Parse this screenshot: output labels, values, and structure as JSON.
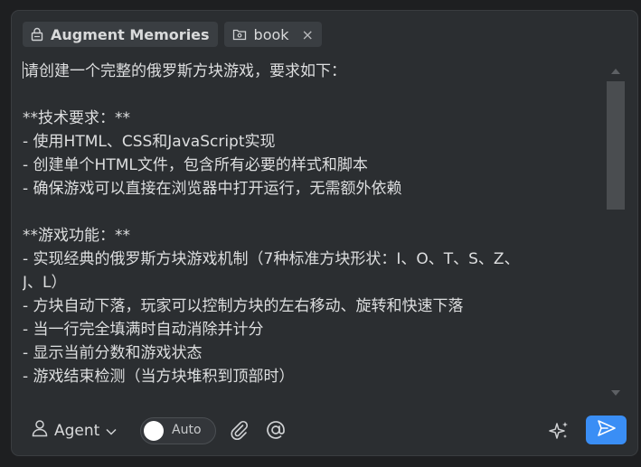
{
  "context_chips": [
    {
      "label": "Augment Memories",
      "icon": "lock-file-icon"
    },
    {
      "label": "book",
      "icon": "folder-icon",
      "close": "×"
    }
  ],
  "prompt": {
    "lines": [
      "请创建一个完整的俄罗斯方块游戏，要求如下：",
      "",
      "**技术要求：**",
      "- 使用HTML、CSS和JavaScript实现",
      "- 创建单个HTML文件，包含所有必要的样式和脚本",
      "- 确保游戏可以直接在浏览器中打开运行，无需额外依赖",
      "",
      "**游戏功能：**",
      "- 实现经典的俄罗斯方块游戏机制（7种标准方块形状：I、O、T、S、Z、",
      "J、L）",
      "- 方块自动下落，玩家可以控制方块的左右移动、旋转和快速下落",
      "- 当一行完全填满时自动消除并计分",
      "- 显示当前分数和游戏状态",
      "- 游戏结束检测（当方块堆积到顶部时）"
    ]
  },
  "toolbar": {
    "mode_label": "Agent",
    "auto_label": "Auto",
    "auto_enabled": false
  },
  "colors": {
    "accent": "#3a8ef5",
    "panel": "#2b2e31"
  }
}
